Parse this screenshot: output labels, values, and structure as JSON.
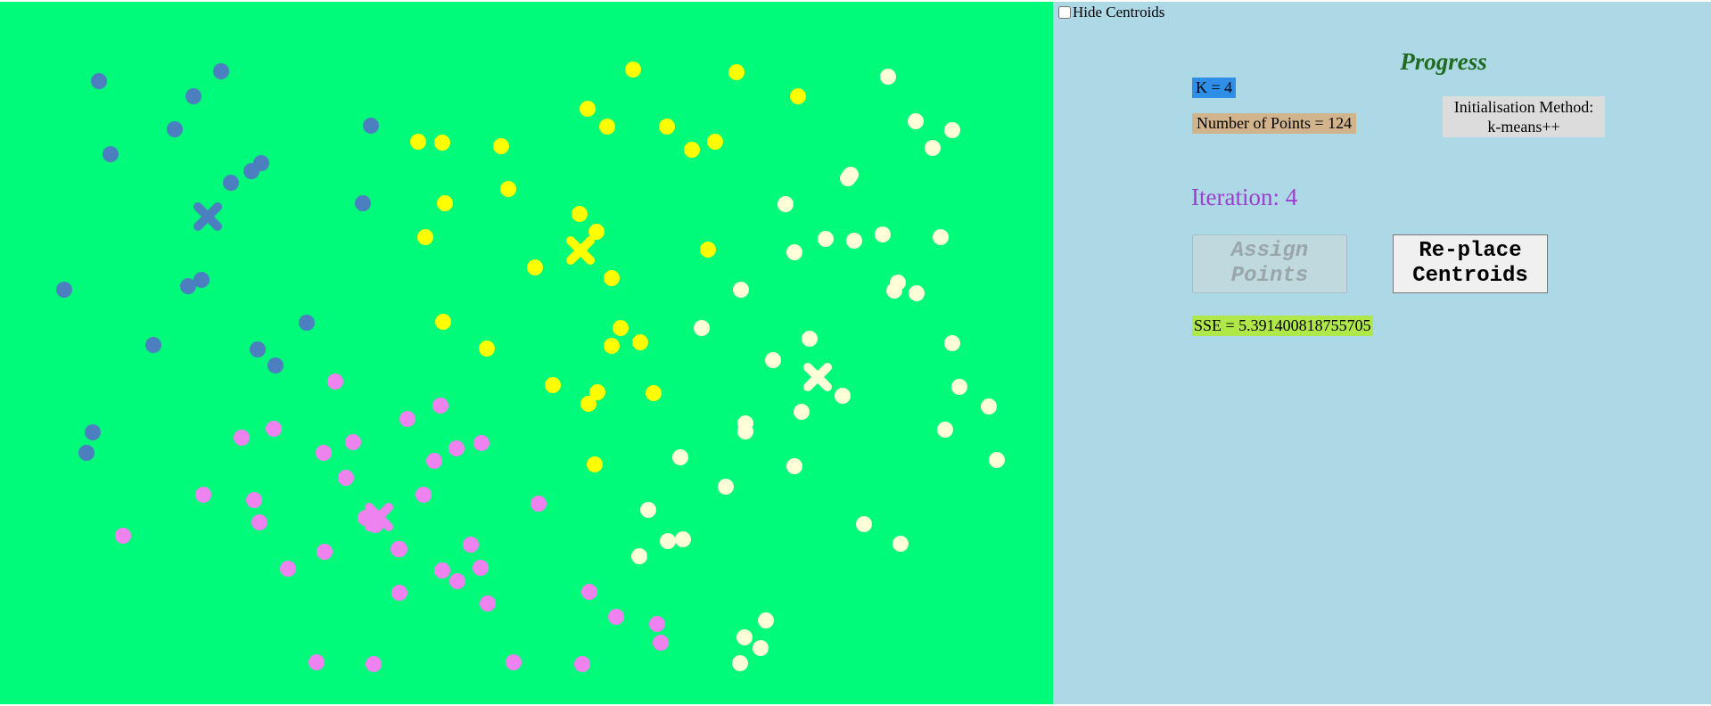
{
  "controls": {
    "hide_centroids_label": "Hide Centroids",
    "hide_centroids_checked": false
  },
  "progress": {
    "title": "Progress",
    "k_label": "K = 4",
    "points_label": "Number of Points = 124",
    "init_line1": "Initialisation Method:",
    "init_line2": "k-means++",
    "iteration_label": "Iteration: 4",
    "assign_button": [
      "Assign",
      "Points"
    ],
    "replace_button": [
      "Re-place",
      "Centroids"
    ],
    "sse_label": "SSE = 5.391400818755705"
  },
  "colors": {
    "canvas_background": "#00fa7a",
    "panel_background": "#add8e6",
    "blue": "#4c7fc0",
    "yellow": "#ffff00",
    "cream": "#ffffd8",
    "pink": "#ee82ee"
  },
  "scatter": {
    "clusters": [
      {
        "color": "blue",
        "centroid": [
          233,
          243
        ],
        "points": [
          [
            111,
            91
          ],
          [
            248,
            80
          ],
          [
            217,
            108
          ],
          [
            196,
            145
          ],
          [
            124,
            173
          ],
          [
            293,
            183
          ],
          [
            282,
            192
          ],
          [
            259,
            205
          ],
          [
            416,
            141
          ],
          [
            407,
            228
          ],
          [
            72,
            325
          ],
          [
            211,
            321
          ],
          [
            226,
            314
          ],
          [
            344,
            362
          ],
          [
            172,
            387
          ],
          [
            289,
            392
          ],
          [
            309,
            410
          ],
          [
            104,
            485
          ],
          [
            97,
            508
          ]
        ]
      },
      {
        "color": "yellow",
        "centroid": [
          651,
          281
        ],
        "points": [
          [
            710,
            78
          ],
          [
            826,
            81
          ],
          [
            895,
            108
          ],
          [
            659,
            122
          ],
          [
            681,
            142
          ],
          [
            748,
            142
          ],
          [
            802,
            159
          ],
          [
            776,
            168
          ],
          [
            469,
            159
          ],
          [
            496,
            160
          ],
          [
            562,
            164
          ],
          [
            570,
            212
          ],
          [
            499,
            228
          ],
          [
            650,
            240
          ],
          [
            669,
            260
          ],
          [
            477,
            266
          ],
          [
            600,
            300
          ],
          [
            686,
            312
          ],
          [
            794,
            280
          ],
          [
            497,
            361
          ],
          [
            546,
            391
          ],
          [
            696,
            368
          ],
          [
            686,
            388
          ],
          [
            718,
            384
          ],
          [
            620,
            432
          ],
          [
            670,
            440
          ],
          [
            660,
            453
          ],
          [
            733,
            441
          ],
          [
            667,
            521
          ]
        ]
      },
      {
        "color": "cream",
        "centroid": [
          917,
          423
        ],
        "points": [
          [
            996,
            86
          ],
          [
            1027,
            136
          ],
          [
            1068,
            146
          ],
          [
            1046,
            166
          ],
          [
            954,
            196
          ],
          [
            951,
            200
          ],
          [
            881,
            229
          ],
          [
            958,
            270
          ],
          [
            926,
            268
          ],
          [
            990,
            263
          ],
          [
            891,
            283
          ],
          [
            1055,
            266
          ],
          [
            1007,
            317
          ],
          [
            1003,
            326
          ],
          [
            1028,
            329
          ],
          [
            831,
            325
          ],
          [
            787,
            368
          ],
          [
            908,
            380
          ],
          [
            867,
            404
          ],
          [
            1068,
            385
          ],
          [
            945,
            444
          ],
          [
            1076,
            434
          ],
          [
            1109,
            456
          ],
          [
            836,
            475
          ],
          [
            899,
            462
          ],
          [
            836,
            484
          ],
          [
            1060,
            482
          ],
          [
            1118,
            516
          ],
          [
            763,
            513
          ],
          [
            891,
            523
          ],
          [
            814,
            546
          ],
          [
            727,
            572
          ],
          [
            969,
            588
          ],
          [
            766,
            605
          ],
          [
            749,
            607
          ],
          [
            717,
            624
          ],
          [
            1010,
            610
          ],
          [
            859,
            696
          ],
          [
            835,
            715
          ],
          [
            853,
            727
          ],
          [
            830,
            744
          ]
        ]
      },
      {
        "color": "pink",
        "centroid": [
          425,
          580
        ],
        "points": [
          [
            376,
            428
          ],
          [
            494,
            455
          ],
          [
            457,
            470
          ],
          [
            307,
            481
          ],
          [
            271,
            491
          ],
          [
            396,
            496
          ],
          [
            363,
            508
          ],
          [
            512,
            503
          ],
          [
            540,
            497
          ],
          [
            487,
            517
          ],
          [
            388,
            536
          ],
          [
            228,
            555
          ],
          [
            604,
            565
          ],
          [
            285,
            561
          ],
          [
            291,
            586
          ],
          [
            475,
            555
          ],
          [
            410,
            581
          ],
          [
            421,
            589
          ],
          [
            447,
            616
          ],
          [
            138,
            601
          ],
          [
            448,
            616
          ],
          [
            528,
            611
          ],
          [
            364,
            619
          ],
          [
            323,
            638
          ],
          [
            496,
            640
          ],
          [
            539,
            637
          ],
          [
            513,
            652
          ],
          [
            448,
            665
          ],
          [
            661,
            664
          ],
          [
            691,
            692
          ],
          [
            737,
            700
          ],
          [
            741,
            721
          ],
          [
            547,
            677
          ],
          [
            355,
            743
          ],
          [
            419,
            745
          ],
          [
            576,
            743
          ],
          [
            653,
            745
          ]
        ]
      }
    ]
  }
}
